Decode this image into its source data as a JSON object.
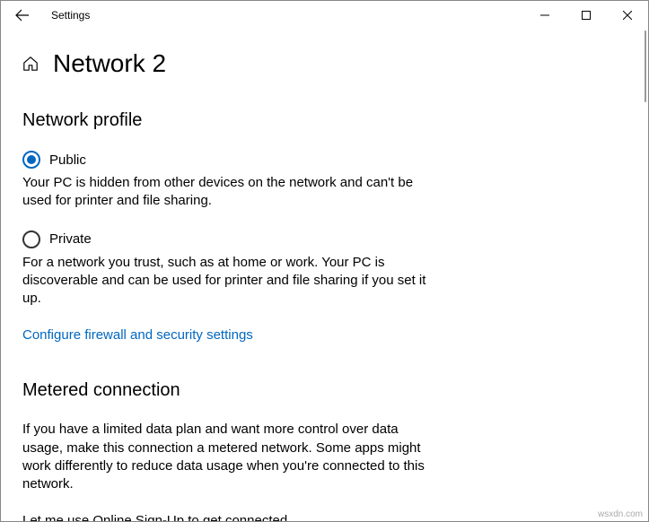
{
  "titlebar": {
    "title": "Settings"
  },
  "page": {
    "title": "Network 2"
  },
  "section_profile": {
    "title": "Network profile",
    "public_label": "Public",
    "public_desc": "Your PC is hidden from other devices on the network and can't be used for printer and file sharing.",
    "private_label": "Private",
    "private_desc": "For a network you trust, such as at home or work. Your PC is discoverable and can be used for printer and file sharing if you set it up.",
    "firewall_link": "Configure firewall and security settings"
  },
  "section_metered": {
    "title": "Metered connection",
    "desc": "If you have a limited data plan and want more control over data usage, make this connection a metered network. Some apps might work differently to reduce data usage when you're connected to this network.",
    "signup_text": "Let me use Online Sign-Up to get connected"
  },
  "watermark": "wsxdn.com"
}
